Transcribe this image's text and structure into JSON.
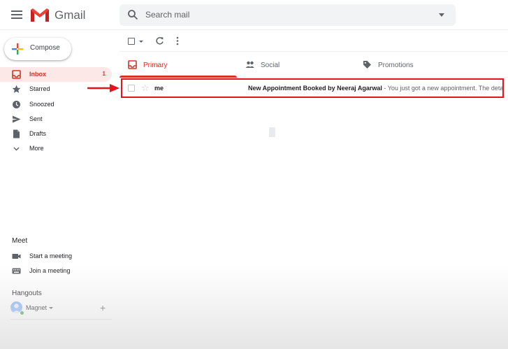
{
  "header": {
    "brand": "Gmail",
    "search_placeholder": "Search mail"
  },
  "sidebar": {
    "compose_label": "Compose",
    "items": [
      {
        "label": "Inbox",
        "count": "1",
        "icon": "inbox-icon",
        "active": true
      },
      {
        "label": "Starred",
        "icon": "star-icon"
      },
      {
        "label": "Snoozed",
        "icon": "clock-icon"
      },
      {
        "label": "Sent",
        "icon": "send-icon"
      },
      {
        "label": "Drafts",
        "icon": "draft-icon"
      },
      {
        "label": "More",
        "icon": "chevron-down-icon"
      }
    ]
  },
  "meet": {
    "title": "Meet",
    "items": [
      {
        "label": "Start a meeting",
        "icon": "video-icon"
      },
      {
        "label": "Join a meeting",
        "icon": "keyboard-icon"
      }
    ]
  },
  "hangouts": {
    "title": "Hangouts",
    "user": "Magnet"
  },
  "tabs": [
    {
      "label": "Primary",
      "icon": "inbox-icon",
      "active": true
    },
    {
      "label": "Social",
      "icon": "people-icon"
    },
    {
      "label": "Promotions",
      "icon": "tag-icon"
    }
  ],
  "emails": [
    {
      "sender": "me",
      "subject": "New Appointment Booked by Neeraj Agarwal",
      "snippet": " - You just got a new appointment. The details"
    }
  ],
  "colors": {
    "accent": "#d93025",
    "highlight_box": "#e8131a",
    "active_nav_bg": "#fce8e6"
  }
}
